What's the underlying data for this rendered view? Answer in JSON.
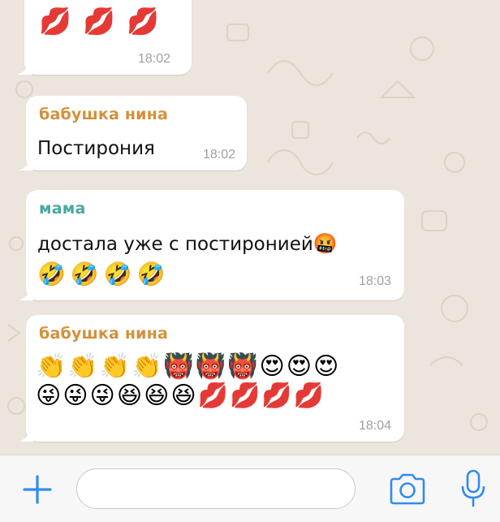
{
  "colors": {
    "wallpaper": "#ece5dd",
    "bubble": "#ffffff",
    "sender_babushka": "#d4903a",
    "sender_mama": "#4aa8a2",
    "accent_icons": "#2f8cf0",
    "timestamp": "#a0a0a0"
  },
  "messages": [
    {
      "emojis": "💋 💋 💋",
      "time": "18:02"
    },
    {
      "sender": "бабушка нина",
      "text": "Постирония",
      "time": "18:02"
    },
    {
      "sender": "мама",
      "text": "достала уже с постиронией",
      "inline_emoji": "🤬",
      "emojis": "🤣🤣🤣🤣",
      "time": "18:03"
    },
    {
      "sender": "бабушка нина",
      "emojis_row1": "👏👏👏👏👹👹👹😍😍😍",
      "emojis_row2": "😜😜😜😆😆😆💋💋💋💋",
      "time": "18:04"
    }
  ],
  "input": {
    "placeholder": "",
    "value": ""
  },
  "icons": {
    "attach": "plus-icon",
    "camera": "camera-icon",
    "mic": "microphone-icon"
  }
}
